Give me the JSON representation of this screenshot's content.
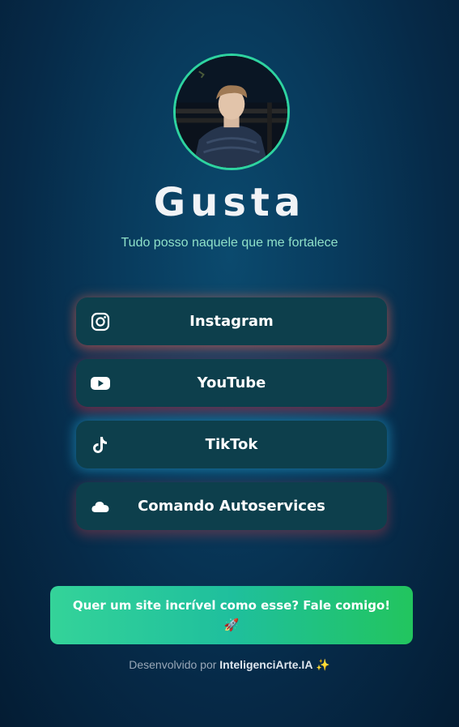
{
  "profile": {
    "name": "Gusta",
    "tagline": "Tudo posso naquele que me fortalece"
  },
  "links": [
    {
      "label": "Instagram",
      "icon": "instagram-icon"
    },
    {
      "label": "YouTube",
      "icon": "youtube-icon"
    },
    {
      "label": "TikTok",
      "icon": "tiktok-icon"
    },
    {
      "label": "Comando Autoservices",
      "icon": "cloud-icon"
    }
  ],
  "cta": {
    "line1": "Quer um site incrível como esse? Fale comigo!",
    "emoji": "🚀"
  },
  "footer": {
    "prefix": "Desenvolvido por",
    "brand": "InteligenciArte.IA",
    "emoji": "✨"
  },
  "colors": {
    "accent": "#2ed3a0",
    "button_bg": "#0d3f4c",
    "cta_start": "#34d399",
    "cta_end": "#22c55e"
  }
}
